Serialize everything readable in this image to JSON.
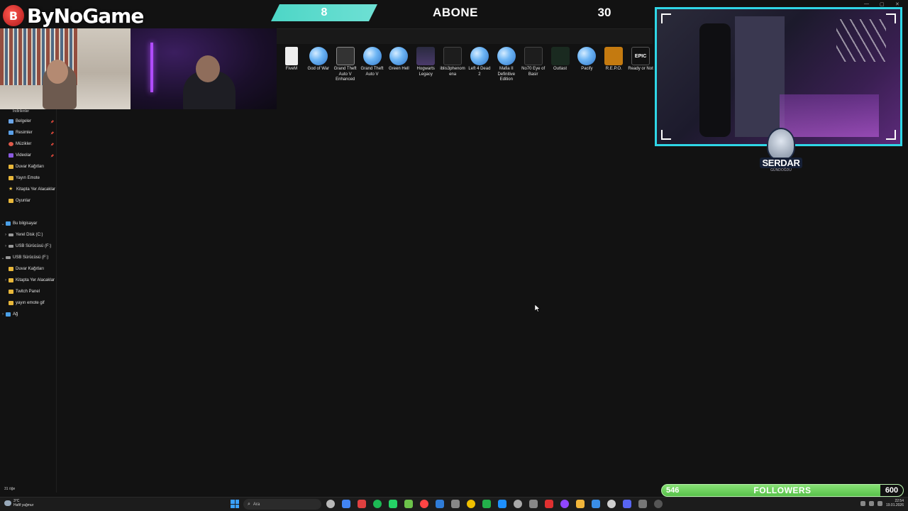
{
  "brand": {
    "name": "ByNoGame",
    "logo_letter": "B"
  },
  "subscription": {
    "current": "8",
    "title": "ABONE",
    "goal": "30"
  },
  "streamer_badge": {
    "name": "SERDAR",
    "subtitle": "GÜNDOĞDU"
  },
  "desktop_icons": [
    {
      "label": "FiveM",
      "icon": "file-icon",
      "style": "file"
    },
    {
      "label": "God of War",
      "icon": "globe-icon",
      "style": "globe"
    },
    {
      "label": "Grand Theft Auto V Enhanced",
      "icon": "gta-icon",
      "style": "gta"
    },
    {
      "label": "Grand Theft Auto V",
      "icon": "globe-icon",
      "style": "globe"
    },
    {
      "label": "Green Hell",
      "icon": "globe-icon",
      "style": "globe"
    },
    {
      "label": "Hogwarts Legacy",
      "icon": "hogwarts-icon",
      "style": "hog"
    },
    {
      "label": "iblis3phenomena",
      "icon": "game-icon",
      "style": "dark"
    },
    {
      "label": "Left 4 Dead 2",
      "icon": "globe-icon",
      "style": "globe"
    },
    {
      "label": "Mafia II Definitive Edition",
      "icon": "globe-icon",
      "style": "globe"
    },
    {
      "label": "No70 Eye of Basir",
      "icon": "game-icon",
      "style": "dark"
    },
    {
      "label": "Outlast",
      "icon": "outlast-icon",
      "style": "green"
    },
    {
      "label": "Pacify",
      "icon": "globe-icon",
      "style": "globe"
    },
    {
      "label": "R.E.P.O.",
      "icon": "repo-icon",
      "style": "repo"
    },
    {
      "label": "Ready or Not",
      "icon": "epic-games-icon",
      "style": "epic",
      "badge": "EPIC"
    }
  ],
  "nav": {
    "top_label": "İndirilenler",
    "quick_access": [
      {
        "label": "Belgeler",
        "icon": "documents-icon",
        "cls": "doc",
        "pinned": true
      },
      {
        "label": "Resimler",
        "icon": "pictures-icon",
        "cls": "pic",
        "pinned": true
      },
      {
        "label": "Müzikler",
        "icon": "music-icon",
        "cls": "music",
        "pinned": true
      },
      {
        "label": "Videolar",
        "icon": "videos-icon",
        "cls": "video",
        "pinned": true
      },
      {
        "label": "Duvar Kağıtları",
        "icon": "folder-icon",
        "cls": "folder",
        "pinned": false
      },
      {
        "label": "Yayın Emote",
        "icon": "folder-icon",
        "cls": "folder",
        "pinned": false
      },
      {
        "label": "Kitapta Yer Alacaklar",
        "icon": "star-icon",
        "cls": "star",
        "pinned": false
      },
      {
        "label": "Oyunlar",
        "icon": "folder-icon",
        "cls": "folder",
        "pinned": false
      }
    ],
    "this_pc": {
      "label": "Bu bilgisayar"
    },
    "drives": [
      {
        "label": "Yerel Disk (C:)"
      },
      {
        "label": "USB Sürücüsü (F:)"
      }
    ],
    "usb_expanded": {
      "label": "USB Sürücüsü (F:)"
    },
    "usb_children": [
      {
        "label": "Duvar Kağıtları",
        "chev": ""
      },
      {
        "label": "Kitapta Yer Alacaklar",
        "chev": "›"
      },
      {
        "label": "Twitch Panel",
        "chev": ""
      },
      {
        "label": "yayın emote gif",
        "chev": ""
      }
    ],
    "network": {
      "label": "Ağ"
    }
  },
  "status": {
    "item_count": "31 öğe"
  },
  "followers": {
    "current": "546",
    "label": "FOLLOWERS",
    "goal": "600",
    "progress": 0.91
  },
  "taskbar": {
    "weather_temp": "3°C",
    "weather_desc": "Hafif yağmur",
    "search_placeholder": "Ara",
    "time": "22:54",
    "date": "19.01.2026"
  },
  "colors": {
    "accent_cyan": "#2fd6e6",
    "subscription_teal": "#4dd6c6",
    "followers_green": "#7dd96b",
    "windows_blue": "#3aa0ff"
  }
}
